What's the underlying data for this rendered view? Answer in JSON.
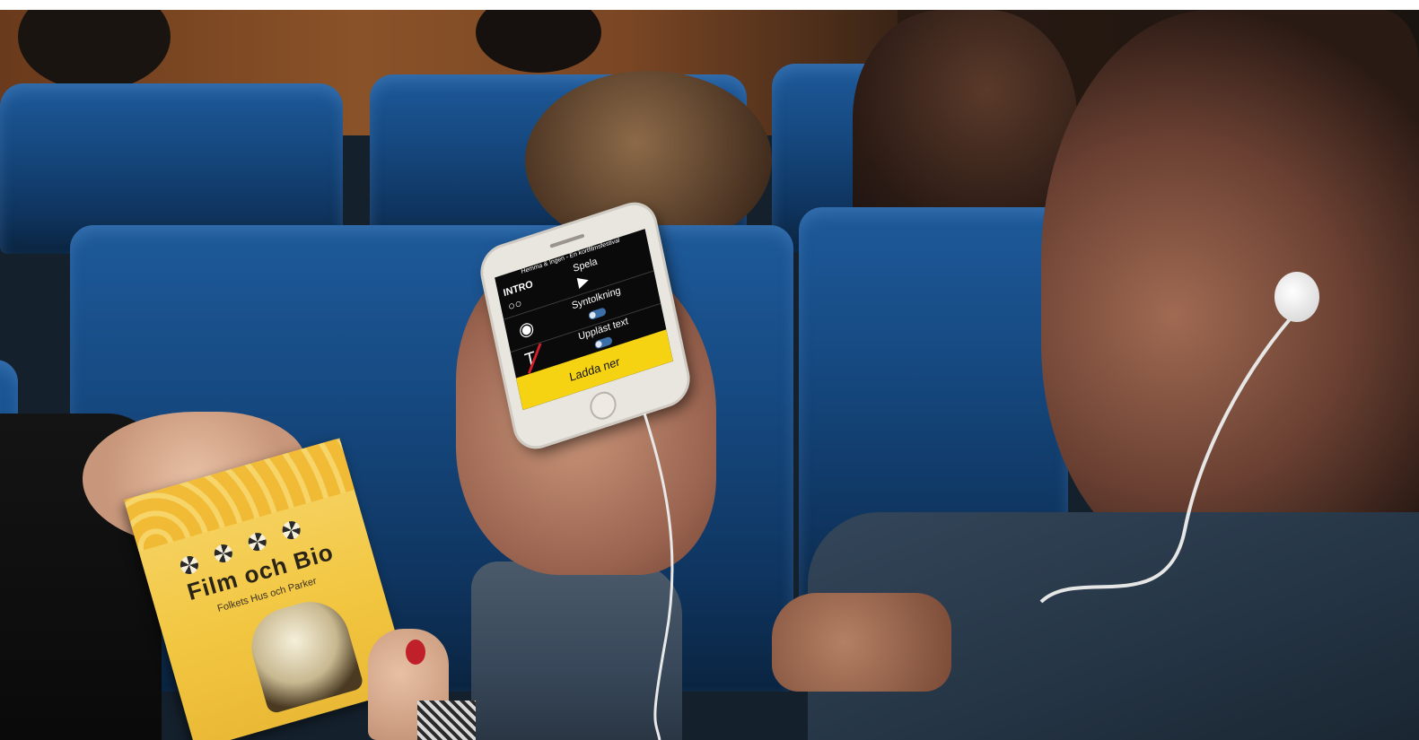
{
  "scene": {
    "description_label": "Cinema audience member using an accessibility app on a phone",
    "colors": {
      "seat_blue": "#164a82",
      "app_accent_yellow": "#f5d313",
      "popcorn_box_yellow": "#f2c640",
      "wall_wood": "#8a5228"
    }
  },
  "phone_app": {
    "status_text": "Hemma & Ingen - En kortfilmsfestival",
    "intro_label": "INTRO",
    "play_label": "Spela",
    "audio_description_label": "Syntolkning",
    "audio_description_enabled": true,
    "read_text_label": "Uppläst text",
    "read_text_enabled": true,
    "download_button_label": "Ladda ner",
    "icons": [
      "binoculars-icon",
      "play-icon",
      "eye-wifi-icon",
      "text-wifi-crossed-icon"
    ]
  },
  "popcorn_box": {
    "title": "Film och Bio",
    "subtitle": "Folkets Hus och Parker"
  }
}
